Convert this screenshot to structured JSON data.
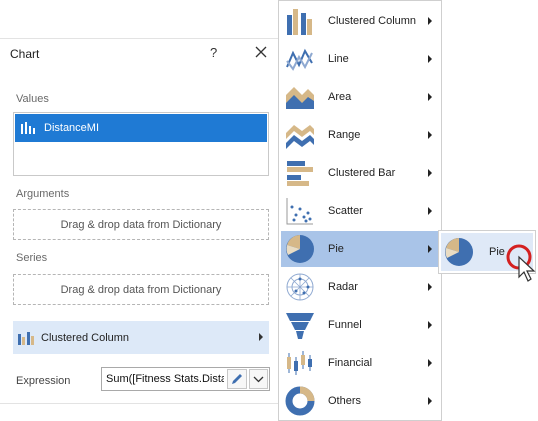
{
  "panel": {
    "title": "Chart",
    "help": "?",
    "values_label": "Values",
    "value_item": "DistanceMI",
    "arguments_label": "Arguments",
    "arguments_drop": "Drag & drop data from Dictionary",
    "series_label": "Series",
    "series_drop": "Drag & drop data from Dictionary",
    "chart_type": "Clustered Column",
    "expression_label": "Expression",
    "expression_value": "Sum([Fitness Stats.Distar"
  },
  "menu": {
    "items": [
      {
        "label": "Clustered Column",
        "icon": "clustered-column-icon"
      },
      {
        "label": "Line",
        "icon": "line-chart-icon"
      },
      {
        "label": "Area",
        "icon": "area-chart-icon"
      },
      {
        "label": "Range",
        "icon": "range-chart-icon"
      },
      {
        "label": "Clustered Bar",
        "icon": "clustered-bar-icon"
      },
      {
        "label": "Scatter",
        "icon": "scatter-chart-icon"
      },
      {
        "label": "Pie",
        "icon": "pie-chart-icon",
        "selected": true
      },
      {
        "label": "Radar",
        "icon": "radar-chart-icon"
      },
      {
        "label": "Funnel",
        "icon": "funnel-chart-icon"
      },
      {
        "label": "Financial",
        "icon": "financial-chart-icon"
      },
      {
        "label": "Others",
        "icon": "donut-chart-icon"
      }
    ]
  },
  "submenu": {
    "items": [
      {
        "label": "Pie",
        "icon": "pie-chart-icon"
      }
    ]
  },
  "colors": {
    "accent": "#1f7ad4",
    "icon_blue": "#3f6fb0",
    "icon_tan": "#d6b888",
    "menu_selected": "#a9c4e8",
    "chart_type_bg": "#dde9f8",
    "cursor_ring": "#d42020"
  }
}
